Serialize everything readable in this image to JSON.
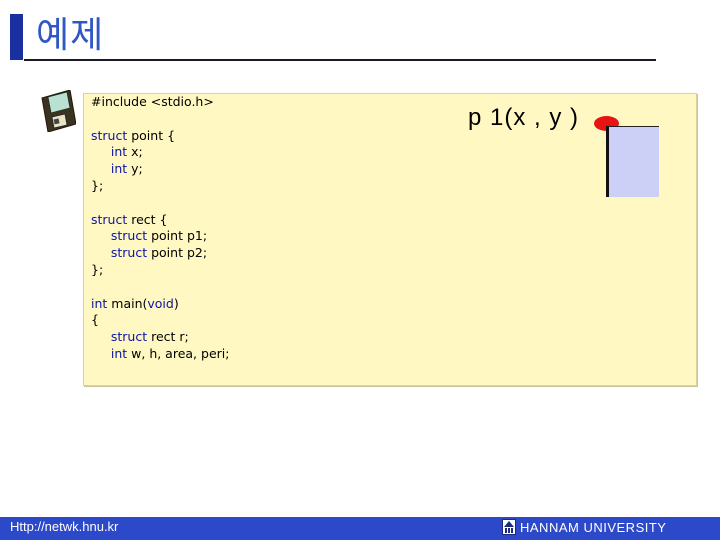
{
  "slide": {
    "title": "예제"
  },
  "code": {
    "lines": [
      [
        {
          "t": "#include <stdio.h>",
          "k": false
        }
      ],
      [],
      [
        {
          "t": "struct",
          "k": true
        },
        {
          "t": " point {",
          "k": false
        }
      ],
      [
        {
          "t": "     ",
          "k": false
        },
        {
          "t": "int",
          "k": true
        },
        {
          "t": " x;",
          "k": false
        }
      ],
      [
        {
          "t": "     ",
          "k": false
        },
        {
          "t": "int",
          "k": true
        },
        {
          "t": " y;",
          "k": false
        }
      ],
      [
        {
          "t": "};",
          "k": false
        }
      ],
      [],
      [
        {
          "t": "struct",
          "k": true
        },
        {
          "t": " rect {",
          "k": false
        }
      ],
      [
        {
          "t": "     ",
          "k": false
        },
        {
          "t": "struct",
          "k": true
        },
        {
          "t": " point p1;",
          "k": false
        }
      ],
      [
        {
          "t": "     ",
          "k": false
        },
        {
          "t": "struct",
          "k": true
        },
        {
          "t": " point p2;",
          "k": false
        }
      ],
      [
        {
          "t": "};",
          "k": false
        }
      ],
      [],
      [
        {
          "t": "int",
          "k": true
        },
        {
          "t": " main(",
          "k": false
        },
        {
          "t": "void",
          "k": true
        },
        {
          "t": ")",
          "k": false
        }
      ],
      [
        {
          "t": "{",
          "k": false
        }
      ],
      [
        {
          "t": "     ",
          "k": false
        },
        {
          "t": "struct",
          "k": true
        },
        {
          "t": " rect r;",
          "k": false
        }
      ],
      [
        {
          "t": "     ",
          "k": false
        },
        {
          "t": "int",
          "k": true
        },
        {
          "t": " w, h, area, peri;",
          "k": false
        }
      ]
    ]
  },
  "diagram": {
    "point_label": "p 1(x , y )",
    "dot_color": "#e81414",
    "rect_color": "#ccd0f6"
  },
  "footer": {
    "url": "Http://netwk.hnu.kr",
    "university": "HANNAM UNIVERSITY",
    "logo_icon": "university-emblem-icon"
  },
  "icons": {
    "disk": "floppy-disk-icon"
  },
  "colors": {
    "title": "#3057c4",
    "accent_bar": "#1a2fa0",
    "footer_bg": "#2c49c9",
    "code_bg": "#fff8c2",
    "keyword": "#0a14a8"
  }
}
